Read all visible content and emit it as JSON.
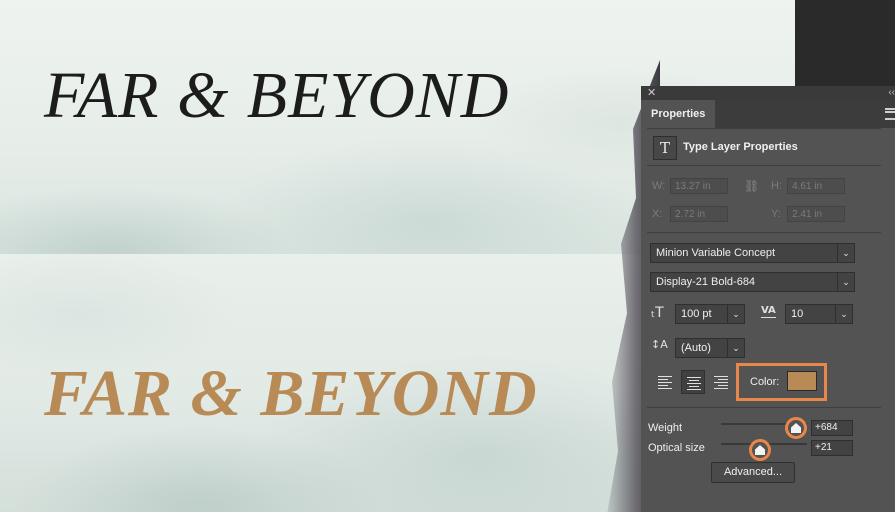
{
  "canvas": {
    "headline_top": "FAR & BEYOND",
    "headline_bottom": "FAR & BEYOND",
    "headline_top_color": "#1c1c1c",
    "headline_bottom_color": "#b88a56"
  },
  "panel": {
    "tab_label": "Properties",
    "section_title": "Type Layer Properties",
    "section_icon": "type-layer-icon",
    "transform": {
      "w_label": "W:",
      "w_value": "13.27 in",
      "h_label": "H:",
      "h_value": "4.61 in",
      "x_label": "X:",
      "x_value": "2.72 in",
      "y_label": "Y:",
      "y_value": "2.41 in"
    },
    "font_family": "Minion Variable Concept",
    "font_style": "Display-21 Bold-684",
    "font_size": "100 pt",
    "tracking": "10",
    "leading": "(Auto)",
    "color_label": "Color:",
    "color_value": "#b88a56",
    "sliders": {
      "weight_label": "Weight",
      "weight_value": "+684",
      "optical_label": "Optical size",
      "optical_value": "+21"
    },
    "advanced_label": "Advanced...",
    "accent": "#e9874a"
  }
}
